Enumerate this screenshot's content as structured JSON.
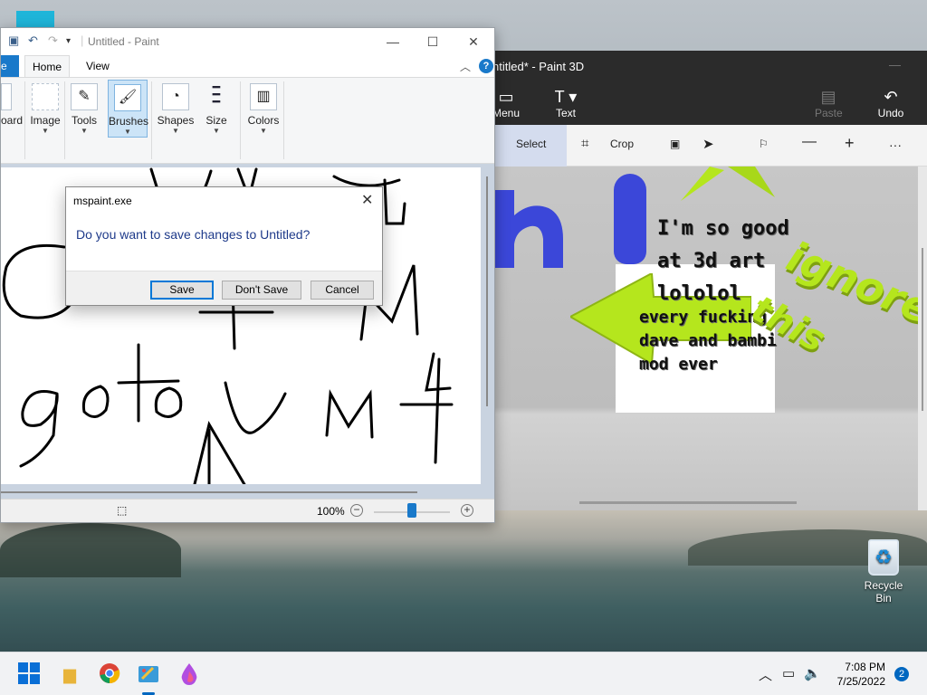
{
  "desktop": {
    "recycle_bin_label": "Recycle Bin"
  },
  "paint3d": {
    "title": "ntitled* - Paint 3D",
    "menu_label": "Menu",
    "text_label": "Text",
    "paste_label": "Paste",
    "undo_label": "Undo",
    "select_label": "Select",
    "crop_label": "Crop",
    "canvas_text_line1": "I'm so good",
    "canvas_text_line2": "at 3d art",
    "canvas_text_line3": "lololol",
    "canvas_text_line4": "every fucking",
    "canvas_text_line5": "dave and bambi",
    "canvas_text_line6": "mod ever",
    "canvas_text_3d_ignore": "ignore",
    "canvas_text_3d_this": "this",
    "canvas_text_3d_hi": "hi"
  },
  "paint": {
    "title": "Untitled - Paint",
    "tab_file": "e",
    "tab_home": "Home",
    "tab_view": "View",
    "groups": {
      "clipboard": "oard",
      "image": "Image",
      "tools": "Tools",
      "brushes": "Brushes",
      "shapes": "Shapes",
      "size": "Size",
      "colors": "Colors"
    },
    "zoom": "100%"
  },
  "dialog": {
    "title": "mspaint.exe",
    "message": "Do you want to save changes to Untitled?",
    "save": "Save",
    "dont_save": "Don't Save",
    "cancel": "Cancel"
  },
  "taskbar": {
    "time": "7:08 PM",
    "date": "7/25/2022",
    "notifications": "2"
  },
  "colors": {
    "accent": "#0078d7",
    "paint3d_dark": "#2b2b2b",
    "lime": "#b5e61d",
    "blue3d": "#3b47d9"
  }
}
